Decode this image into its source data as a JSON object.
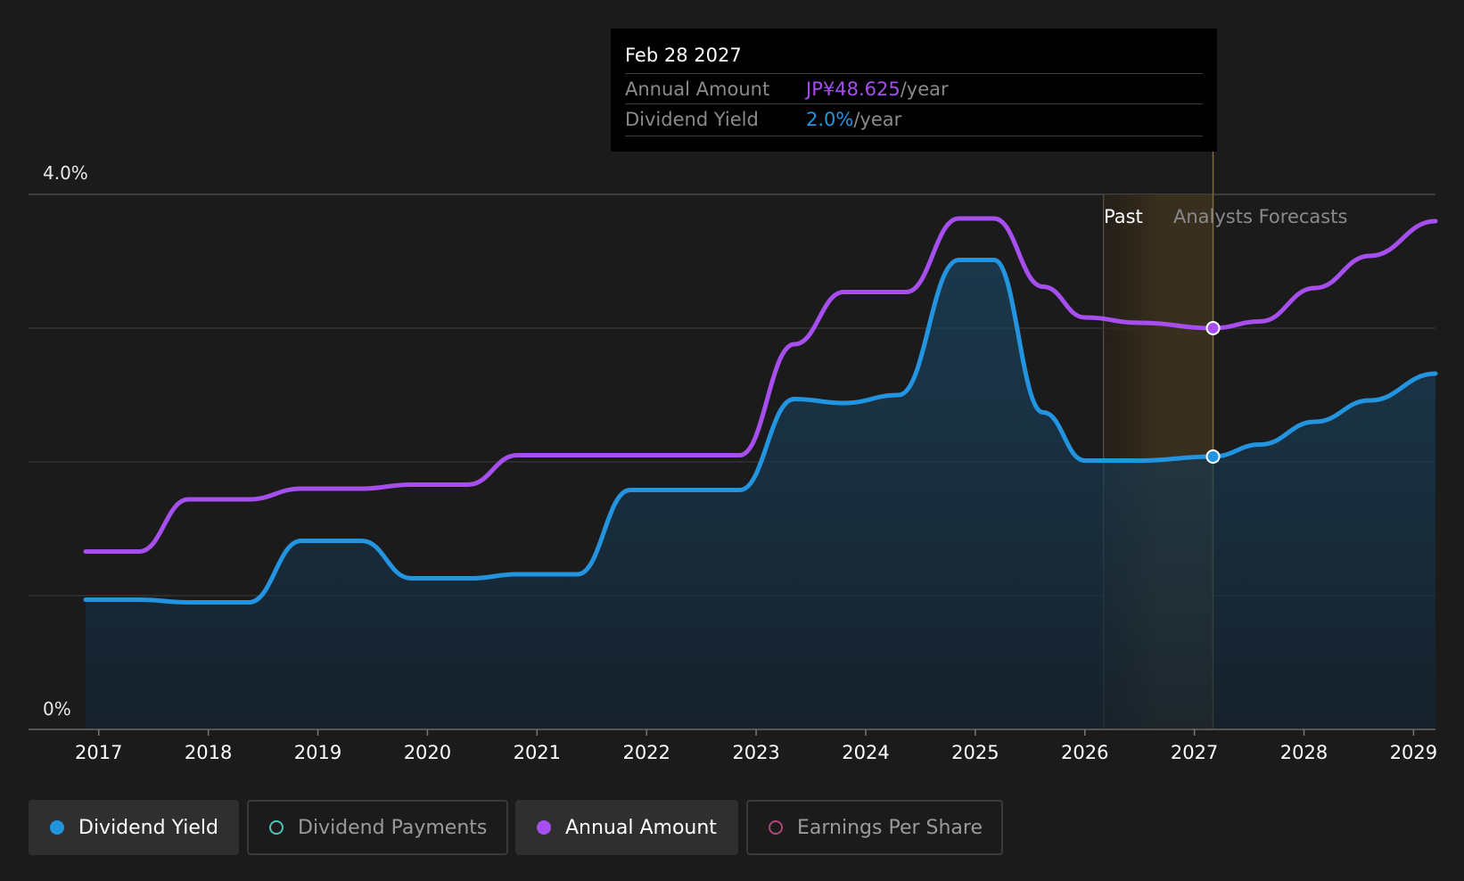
{
  "chart_data": {
    "type": "area",
    "ylabels": [
      "4.0%",
      "0%"
    ],
    "ylim": [
      0,
      4.0
    ],
    "xlim": [
      2016.88,
      2029.2
    ],
    "x_ticks": [
      "2017",
      "2018",
      "2019",
      "2020",
      "2021",
      "2022",
      "2023",
      "2024",
      "2025",
      "2026",
      "2027",
      "2028",
      "2029"
    ],
    "regions": {
      "past_label": "Past",
      "forecast_label": "Analysts Forecasts",
      "past_start": 2026.17,
      "past_end": 2026.64,
      "forecast_end": 2027.17
    },
    "series": [
      {
        "name": "Annual Amount",
        "color": "#a64eee",
        "points": [
          [
            2016.88,
            1.33
          ],
          [
            2017.37,
            1.33
          ],
          [
            2017.82,
            1.72
          ],
          [
            2018.37,
            1.72
          ],
          [
            2018.85,
            1.8
          ],
          [
            2019.4,
            1.8
          ],
          [
            2019.85,
            1.83
          ],
          [
            2020.37,
            1.83
          ],
          [
            2020.82,
            2.05
          ],
          [
            2022.85,
            2.05
          ],
          [
            2023.35,
            2.88
          ],
          [
            2023.8,
            3.27
          ],
          [
            2024.37,
            3.27
          ],
          [
            2024.85,
            3.82
          ],
          [
            2025.17,
            3.82
          ],
          [
            2025.62,
            3.31
          ],
          [
            2026.0,
            3.08
          ],
          [
            2026.5,
            3.04
          ],
          [
            2027.17,
            3.0
          ],
          [
            2027.6,
            3.05
          ],
          [
            2028.1,
            3.3
          ],
          [
            2028.6,
            3.54
          ],
          [
            2029.2,
            3.8
          ]
        ]
      },
      {
        "name": "Dividend Yield",
        "color": "#2394df",
        "points": [
          [
            2016.88,
            0.97
          ],
          [
            2017.37,
            0.97
          ],
          [
            2017.82,
            0.95
          ],
          [
            2018.37,
            0.95
          ],
          [
            2018.85,
            1.41
          ],
          [
            2019.4,
            1.41
          ],
          [
            2019.85,
            1.13
          ],
          [
            2020.4,
            1.13
          ],
          [
            2020.82,
            1.16
          ],
          [
            2021.37,
            1.16
          ],
          [
            2021.85,
            1.79
          ],
          [
            2022.85,
            1.79
          ],
          [
            2023.35,
            2.47
          ],
          [
            2023.8,
            2.44
          ],
          [
            2024.3,
            2.5
          ],
          [
            2024.85,
            3.51
          ],
          [
            2025.17,
            3.51
          ],
          [
            2025.62,
            2.37
          ],
          [
            2026.0,
            2.01
          ],
          [
            2026.5,
            2.01
          ],
          [
            2027.17,
            2.04
          ],
          [
            2027.6,
            2.13
          ],
          [
            2028.1,
            2.3
          ],
          [
            2028.6,
            2.46
          ],
          [
            2029.2,
            2.66
          ]
        ]
      }
    ],
    "marker_x": 2027.17,
    "markers": [
      {
        "series": "Annual Amount",
        "y": 3.0,
        "color": "#a64eee"
      },
      {
        "series": "Dividend Yield",
        "y": 2.04,
        "color": "#2394df"
      }
    ],
    "gridlines": [
      4.0,
      3.0,
      2.0,
      1.0,
      0
    ]
  },
  "tooltip": {
    "date": "Feb 28 2027",
    "annual_label": "Annual Amount",
    "annual_value": "JP¥48.625",
    "yield_label": "Dividend Yield",
    "yield_value": "2.0%",
    "unit": "/year",
    "annual_color": "#a64eee",
    "yield_color": "#2394df"
  },
  "legend": [
    {
      "label": "Dividend Yield",
      "color": "#2394df",
      "active": true,
      "filled": true
    },
    {
      "label": "Dividend Payments",
      "color": "#4fc3b7",
      "active": false,
      "filled": false
    },
    {
      "label": "Annual Amount",
      "color": "#a64eee",
      "active": true,
      "filled": true
    },
    {
      "label": "Earnings Per Share",
      "color": "#b0457a",
      "active": false,
      "filled": false
    }
  ]
}
